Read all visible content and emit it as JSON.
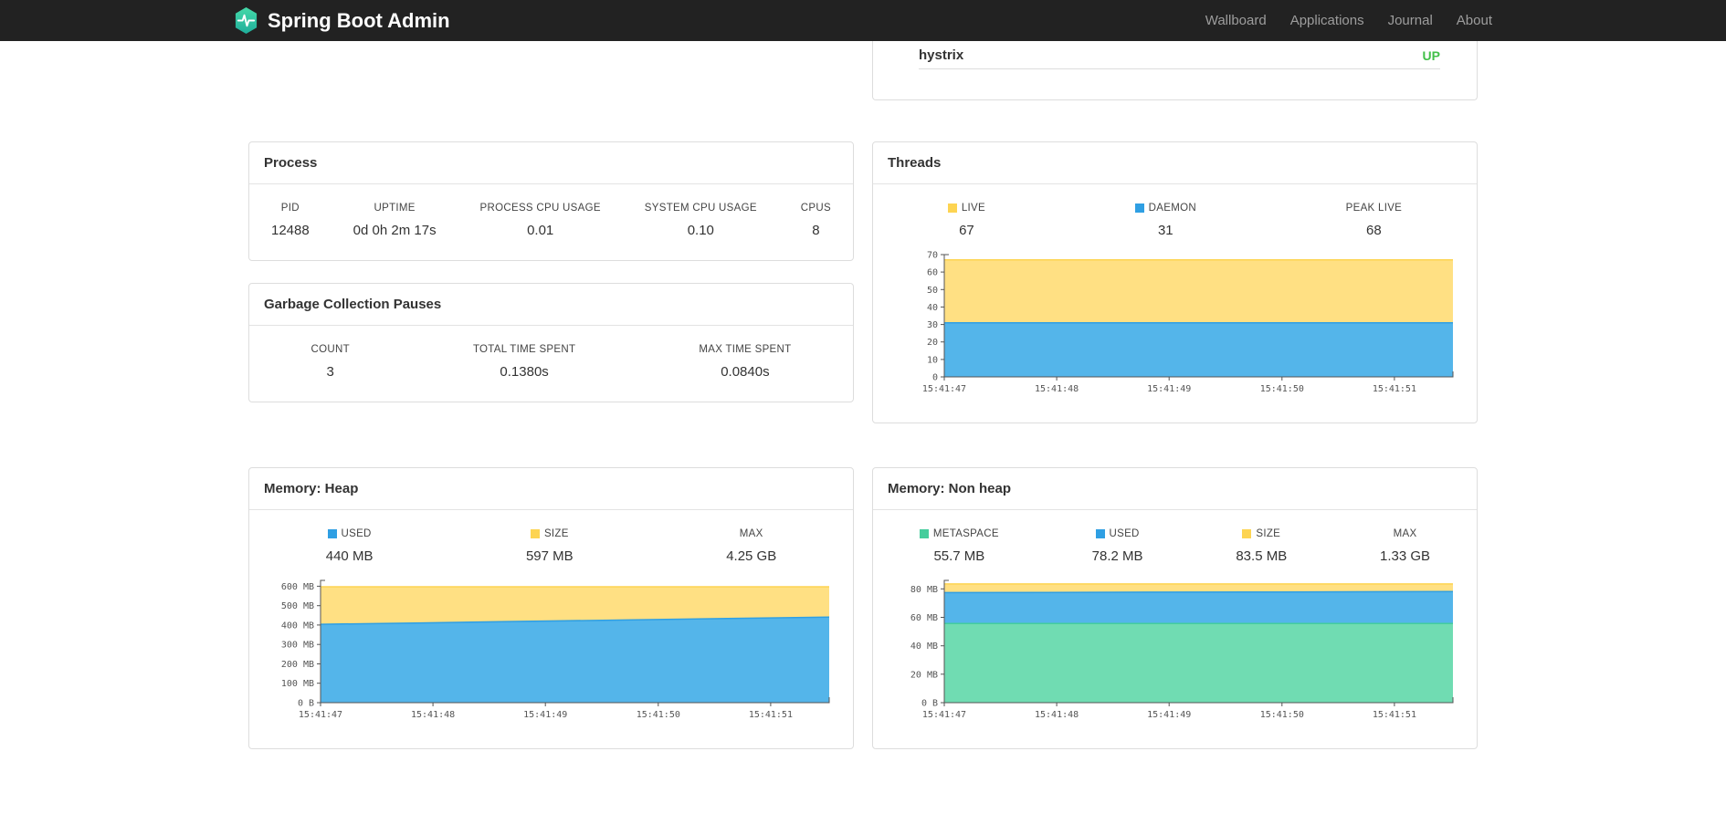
{
  "navbar": {
    "brand": "Spring Boot Admin",
    "links": [
      {
        "label": "Wallboard"
      },
      {
        "label": "Applications"
      },
      {
        "label": "Journal"
      },
      {
        "label": "About"
      }
    ],
    "logo_color_top": "#45D9A8",
    "logo_color_bottom": "#1FAE9B"
  },
  "applications_panel": {
    "rows": [
      {
        "name": "hystrix",
        "status": "UP",
        "status_color": "#42C049"
      }
    ]
  },
  "process": {
    "title": "Process",
    "stats": [
      {
        "label": "PID",
        "value": "12488"
      },
      {
        "label": "UPTIME",
        "value": "0d 0h 2m 17s"
      },
      {
        "label": "PROCESS CPU USAGE",
        "value": "0.01"
      },
      {
        "label": "SYSTEM CPU USAGE",
        "value": "0.10"
      },
      {
        "label": "CPUS",
        "value": "8"
      }
    ]
  },
  "gc": {
    "title": "Garbage Collection Pauses",
    "stats": [
      {
        "label": "COUNT",
        "value": "3"
      },
      {
        "label": "TOTAL TIME SPENT",
        "value": "0.1380s"
      },
      {
        "label": "MAX TIME SPENT",
        "value": "0.0840s"
      }
    ]
  },
  "threads": {
    "title": "Threads",
    "stats": [
      {
        "label": "LIVE",
        "value": "67",
        "swatch": "#FDD452"
      },
      {
        "label": "DAEMON",
        "value": "31",
        "swatch": "#2F9FE3"
      },
      {
        "label": "PEAK LIVE",
        "value": "68"
      }
    ]
  },
  "heap": {
    "title": "Memory: Heap",
    "stats": [
      {
        "label": "USED",
        "value": "440 MB",
        "swatch": "#2F9FE3"
      },
      {
        "label": "SIZE",
        "value": "597 MB",
        "swatch": "#FDD452"
      },
      {
        "label": "MAX",
        "value": "4.25 GB"
      }
    ]
  },
  "nonheap": {
    "title": "Memory: Non heap",
    "stats": [
      {
        "label": "METASPACE",
        "value": "55.7 MB",
        "swatch": "#45CD9C"
      },
      {
        "label": "USED",
        "value": "78.2 MB",
        "swatch": "#2F9FE3"
      },
      {
        "label": "SIZE",
        "value": "83.5 MB",
        "swatch": "#FDD452"
      },
      {
        "label": "MAX",
        "value": "1.33 GB"
      }
    ]
  },
  "chart_data": [
    {
      "name": "threads",
      "type": "area",
      "title": "Threads",
      "stacked": true,
      "grid": false,
      "ylim": [
        0,
        70
      ],
      "y_ticks": [
        {
          "v": 0,
          "label": "0"
        },
        {
          "v": 10,
          "label": "10"
        },
        {
          "v": 20,
          "label": "20"
        },
        {
          "v": 30,
          "label": "30"
        },
        {
          "v": 40,
          "label": "40"
        },
        {
          "v": 50,
          "label": "50"
        },
        {
          "v": 60,
          "label": "60"
        },
        {
          "v": 70,
          "label": "70"
        }
      ],
      "x_labels": [
        "15:41:47",
        "15:41:48",
        "15:41:49",
        "15:41:50",
        "15:41:51"
      ],
      "x_positions": [
        0,
        0.221,
        0.442,
        0.664,
        0.885
      ],
      "series": [
        {
          "name": "LIVE",
          "fill": "#FFE083",
          "line": "#FDD452",
          "values": [
            67,
            67,
            67,
            67,
            67,
            67
          ]
        },
        {
          "name": "DAEMON",
          "fill": "#54B5EA",
          "line": "#2F9FE3",
          "values": [
            31,
            31,
            31,
            31,
            31,
            31
          ]
        }
      ]
    },
    {
      "name": "memory-heap",
      "type": "area",
      "title": "Memory: Heap",
      "stacked": false,
      "grid": false,
      "ylim": [
        0,
        630
      ],
      "y_ticks": [
        {
          "v": 0,
          "label": "0 B"
        },
        {
          "v": 100,
          "label": "100 MB"
        },
        {
          "v": 200,
          "label": "200 MB"
        },
        {
          "v": 300,
          "label": "300 MB"
        },
        {
          "v": 400,
          "label": "400 MB"
        },
        {
          "v": 500,
          "label": "500 MB"
        },
        {
          "v": 600,
          "label": "600 MB"
        }
      ],
      "x_labels": [
        "15:41:47",
        "15:41:48",
        "15:41:49",
        "15:41:50",
        "15:41:51"
      ],
      "x_positions": [
        0,
        0.221,
        0.442,
        0.664,
        0.885
      ],
      "series": [
        {
          "name": "SIZE",
          "fill": "#FFE083",
          "line": "#FDD452",
          "values": [
            597,
            597,
            597,
            597,
            597,
            597
          ]
        },
        {
          "name": "USED",
          "fill": "#54B5EA",
          "line": "#2F9FE3",
          "values": [
            404,
            411,
            419,
            426,
            434,
            441
          ]
        }
      ]
    },
    {
      "name": "memory-nonheap",
      "type": "area",
      "title": "Memory: Non heap",
      "stacked": false,
      "grid": false,
      "ylim": [
        0,
        86
      ],
      "y_ticks": [
        {
          "v": 0,
          "label": "0 B"
        },
        {
          "v": 20,
          "label": "20 MB"
        },
        {
          "v": 40,
          "label": "40 MB"
        },
        {
          "v": 60,
          "label": "60 MB"
        },
        {
          "v": 80,
          "label": "80 MB"
        }
      ],
      "x_labels": [
        "15:41:47",
        "15:41:48",
        "15:41:49",
        "15:41:50",
        "15:41:51"
      ],
      "x_positions": [
        0,
        0.221,
        0.442,
        0.664,
        0.885
      ],
      "series": [
        {
          "name": "SIZE",
          "fill": "#FFE083",
          "line": "#FDD452",
          "values": [
            83.5,
            83.5,
            83.5,
            83.5,
            83.5,
            83.5
          ]
        },
        {
          "name": "USED",
          "fill": "#54B5EA",
          "line": "#2F9FE3",
          "values": [
            77.4,
            77.5,
            77.7,
            77.8,
            78.0,
            78.2
          ]
        },
        {
          "name": "METASPACE",
          "fill": "#70DCB2",
          "line": "#45CD9C",
          "values": [
            55.7,
            55.7,
            55.7,
            55.7,
            55.7,
            55.7
          ]
        }
      ]
    }
  ]
}
